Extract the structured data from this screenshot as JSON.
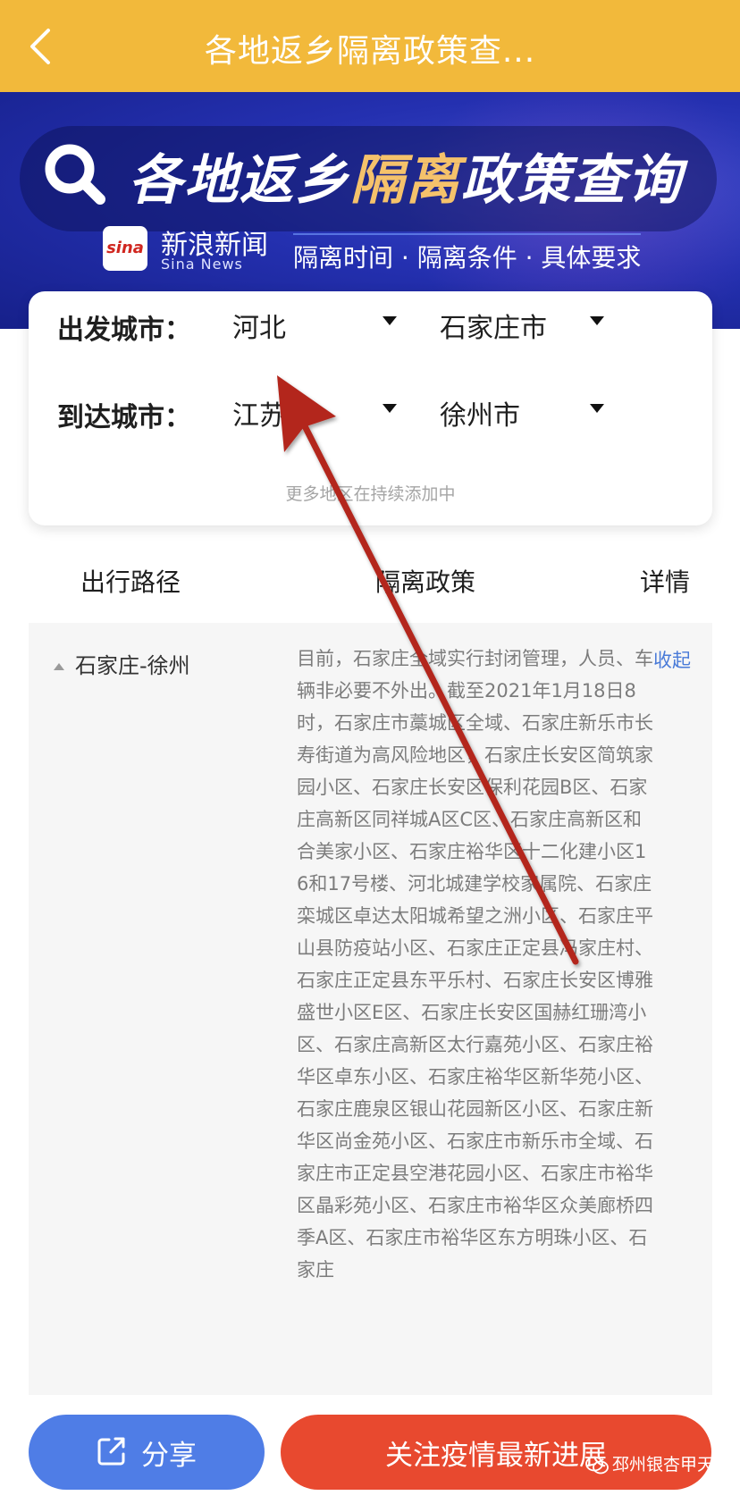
{
  "nav": {
    "title": "各地返乡隔离政策查...",
    "back_icon": "chevron-left-icon"
  },
  "banner": {
    "title_part1": "各地返乡",
    "title_part2": "隔离",
    "title_part3": "政策查询",
    "logo_text": "sina",
    "brand_name": "新浪新闻",
    "brand_en": "Sina News",
    "subtitle": "隔离时间 · 隔离条件 · 具体要求"
  },
  "selector": {
    "departure_label": "出发城市：",
    "departure_province": "河北",
    "departure_city": "石家庄市",
    "arrival_label": "到达城市：",
    "arrival_province": "江苏",
    "arrival_city": "徐州市",
    "hint": "更多地区在持续添加中"
  },
  "table": {
    "col_route": "出行路径",
    "col_policy": "隔离政策",
    "col_detail": "详情",
    "row": {
      "route": "石家庄-徐州",
      "policy": "目前，石家庄全域实行封闭管理，人员、车辆非必要不外出。截至2021年1月18日8时，石家庄市藁城区全域、石家庄新乐市长寿街道为高风险地区，石家庄长安区简筑家园小区、石家庄长安区保利花园B区、石家庄高新区同祥城A区C区、石家庄高新区和合美家小区、石家庄裕华区十二化建小区16和17号楼、河北城建学校家属院、石家庄栾城区卓达太阳城希望之洲小区、石家庄平山县防疫站小区、石家庄正定县冯家庄村、石家庄正定县东平乐村、石家庄长安区博雅盛世小区E区、石家庄长安区国赫红珊湾小区、石家庄高新区太行嘉苑小区、石家庄裕华区卓东小区、石家庄裕华区新华苑小区、石家庄鹿泉区银山花园新区小区、石家庄新华区尚金苑小区、石家庄市新乐市全域、石家庄市正定县空港花园小区、石家庄市裕华区晶彩苑小区、石家庄市裕华区众美廊桥四季A区、石家庄市裕华区东方明珠小区、石家庄",
      "action": "收起"
    }
  },
  "footer": {
    "share_label": "分享",
    "follow_label": "关注疫情最新进展",
    "watermark": "邳州银杏甲天下"
  },
  "colors": {
    "topbar": "#f2b93b",
    "share_button": "#4f7de6",
    "follow_button": "#e8492f",
    "annotation_arrow": "#b3261e",
    "link": "#4a7bd8"
  }
}
